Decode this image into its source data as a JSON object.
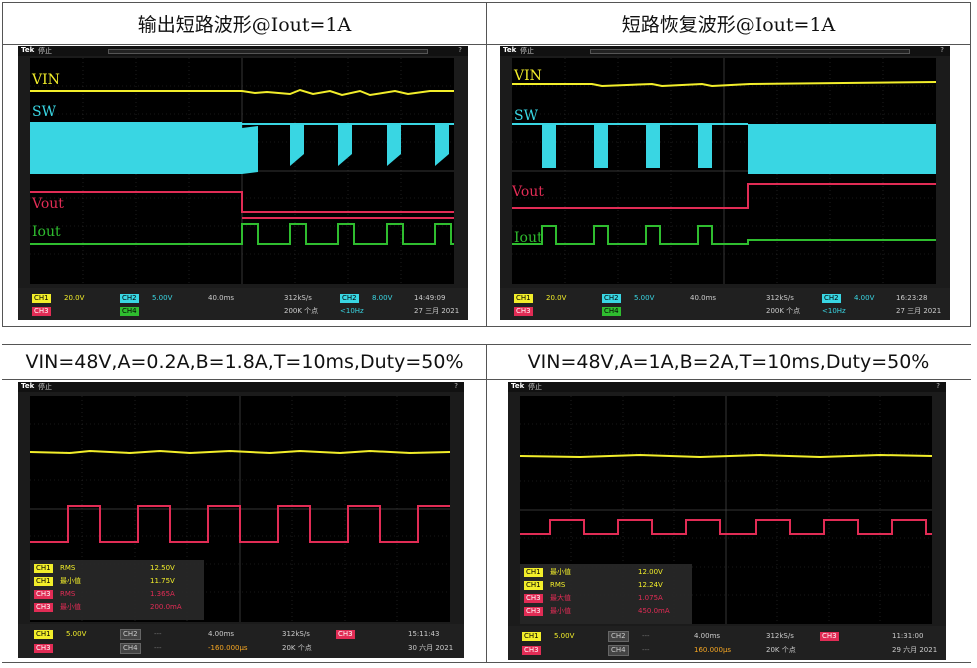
{
  "titles": {
    "short_circuit": "输出短路波形@Iout=1A",
    "recovery": "短路恢复波形@Iout=1A",
    "load1": "VIN=48V,A=0.2A,B=1.8A,T=10ms,Duty=50%",
    "load2": "VIN=48V,A=1A,B=2A,T=10ms,Duty=50%"
  },
  "scope_common": {
    "brand": "Tek",
    "stop_label": "停止",
    "help": "?"
  },
  "colors": {
    "ch1": "#f2ee2a",
    "ch2": "#39d6e3",
    "ch3": "#e12c55",
    "ch4": "#2fbd2f"
  },
  "scope1": {
    "labels": {
      "vin": "VIN",
      "sw": "SW",
      "vout": "Vout",
      "iout": "Iout"
    },
    "ch1": "CH1",
    "ch1_scale": "20.0V",
    "ch2": "CH2",
    "ch2_scale": "5.00V",
    "ch3": "CH3",
    "ch4": "CH4",
    "timebase": "40.0ms",
    "rate": "312kS/s",
    "points": "200K 个点",
    "trig_ch": "CH2",
    "trig_level": "8.00V",
    "trig_freq": "<10Hz",
    "time": "14:49:09",
    "date": "27 三月 2021"
  },
  "scope2": {
    "labels": {
      "vin": "VIN",
      "sw": "SW",
      "vout": "Vout",
      "iout": "Iout"
    },
    "ch1": "CH1",
    "ch1_scale": "20.0V",
    "ch2": "CH2",
    "ch2_scale": "5.00V",
    "ch3": "CH3",
    "ch4": "CH4",
    "timebase": "40.0ms",
    "rate": "312kS/s",
    "points": "200K 个点",
    "trig_ch": "CH2",
    "trig_level": "4.00V",
    "trig_freq": "<10Hz",
    "time": "16:23:28",
    "date": "27 三月 2021"
  },
  "scope3": {
    "measurements": [
      {
        "ch": "CH1",
        "name": "RMS",
        "value": "12.50V"
      },
      {
        "ch": "CH1",
        "name": "最小值",
        "value": "11.75V"
      },
      {
        "ch": "CH3",
        "name": "RMS",
        "value": "1.365A"
      },
      {
        "ch": "CH3",
        "name": "最小值",
        "value": "200.0mA"
      }
    ],
    "ch1": "CH1",
    "ch1_scale": "5.00V",
    "ch2": "CH2",
    "ch3": "CH3",
    "ch4": "CH4",
    "dash": "---",
    "timebase": "4.00ms",
    "offset": "-160.000µs",
    "rate": "312kS/s",
    "points": "20K 个点",
    "trig_ch": "CH3",
    "time": "15:11:43",
    "date": "30 六月 2021"
  },
  "scope4": {
    "measurements": [
      {
        "ch": "CH1",
        "name": "最小值",
        "value": "12.00V"
      },
      {
        "ch": "CH1",
        "name": "RMS",
        "value": "12.24V"
      },
      {
        "ch": "CH3",
        "name": "最大值",
        "value": "1.075A"
      },
      {
        "ch": "CH3",
        "name": "最小值",
        "value": "450.0mA"
      }
    ],
    "ch1": "CH1",
    "ch1_scale": "5.00V",
    "ch2": "CH2",
    "ch3": "CH3",
    "ch4": "CH4",
    "dash": "---",
    "timebase": "4.00ms",
    "offset": "160.000µs",
    "rate": "312kS/s",
    "points": "20K 个点",
    "trig_ch": "CH3",
    "time": "11:31:00",
    "date": "29 六月 2021"
  }
}
